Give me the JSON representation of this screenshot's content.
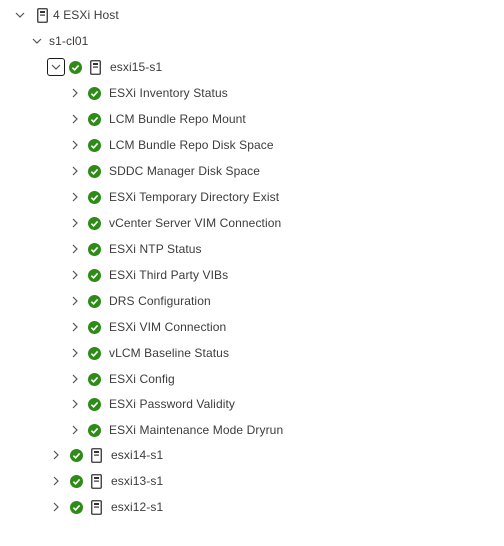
{
  "tree": {
    "root": {
      "label": "4 ESXi Host",
      "icon": "server-icon"
    },
    "cluster": {
      "label": "s1-cl01"
    },
    "hosts": [
      {
        "label": "esxi15-s1",
        "status": "success",
        "expanded": true,
        "checks": [
          "ESXi Inventory Status",
          "LCM Bundle Repo Mount",
          "LCM Bundle Repo Disk Space",
          "SDDC Manager Disk Space",
          "ESXi Temporary Directory Exist",
          "vCenter Server VIM Connection",
          "ESXi NTP Status",
          "ESXi Third Party VIBs",
          "DRS Configuration",
          "ESXi VIM Connection",
          "vLCM Baseline Status",
          "ESXi Config",
          "ESXi Password Validity",
          "ESXi Maintenance Mode Dryrun"
        ]
      },
      {
        "label": "esxi14-s1",
        "status": "success",
        "expanded": false
      },
      {
        "label": "esxi13-s1",
        "status": "success",
        "expanded": false
      },
      {
        "label": "esxi12-s1",
        "status": "success",
        "expanded": false
      }
    ]
  },
  "colors": {
    "success": "#2e8b17",
    "chevron": "#555555",
    "text": "#3c3c3c"
  }
}
